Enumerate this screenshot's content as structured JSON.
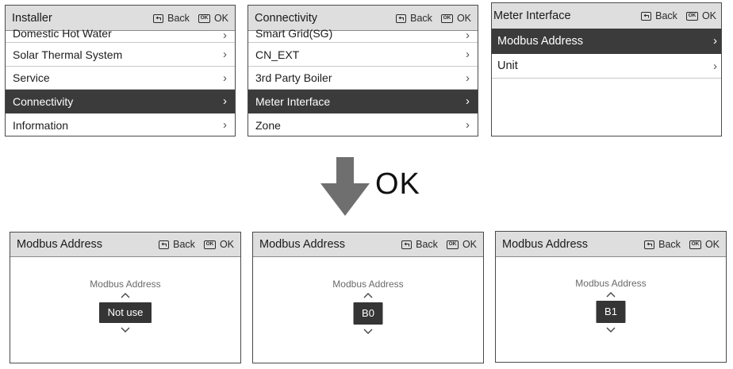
{
  "header": {
    "back_label": "Back",
    "ok_label": "OK"
  },
  "installer": {
    "title": "Installer",
    "items": [
      {
        "label": "Domestic Hot Water"
      },
      {
        "label": "Solar Thermal System"
      },
      {
        "label": "Service"
      },
      {
        "label": "Connectivity"
      },
      {
        "label": "Information"
      }
    ],
    "selected": "Connectivity"
  },
  "connectivity": {
    "title": "Connectivity",
    "items": [
      {
        "label": "Smart Grid(SG)"
      },
      {
        "label": "CN_EXT"
      },
      {
        "label": "3rd Party Boiler"
      },
      {
        "label": "Meter Interface"
      },
      {
        "label": "Zone"
      }
    ],
    "selected": "Meter Interface"
  },
  "meter": {
    "title": "Meter Interface",
    "items": [
      {
        "label": "Modbus Address"
      },
      {
        "label": "Unit"
      }
    ],
    "selected": "Modbus Address"
  },
  "transition": {
    "label": "OK"
  },
  "modbus_screens": [
    {
      "title": "Modbus Address",
      "caption": "Modbus Address",
      "value": "Not use"
    },
    {
      "title": "Modbus Address",
      "caption": "Modbus Address",
      "value": "B0"
    },
    {
      "title": "Modbus Address",
      "caption": "Modbus Address",
      "value": "B1"
    }
  ],
  "colors": {
    "selected_row": "#3b3b3b",
    "header_bg": "#dedede",
    "arrow": "#6f6f6f"
  },
  "icons": {
    "back": "back-return-icon",
    "ok": "ok-key-icon",
    "row": "chevron-right-icon",
    "up": "caret-up-icon",
    "down": "caret-down-icon"
  }
}
